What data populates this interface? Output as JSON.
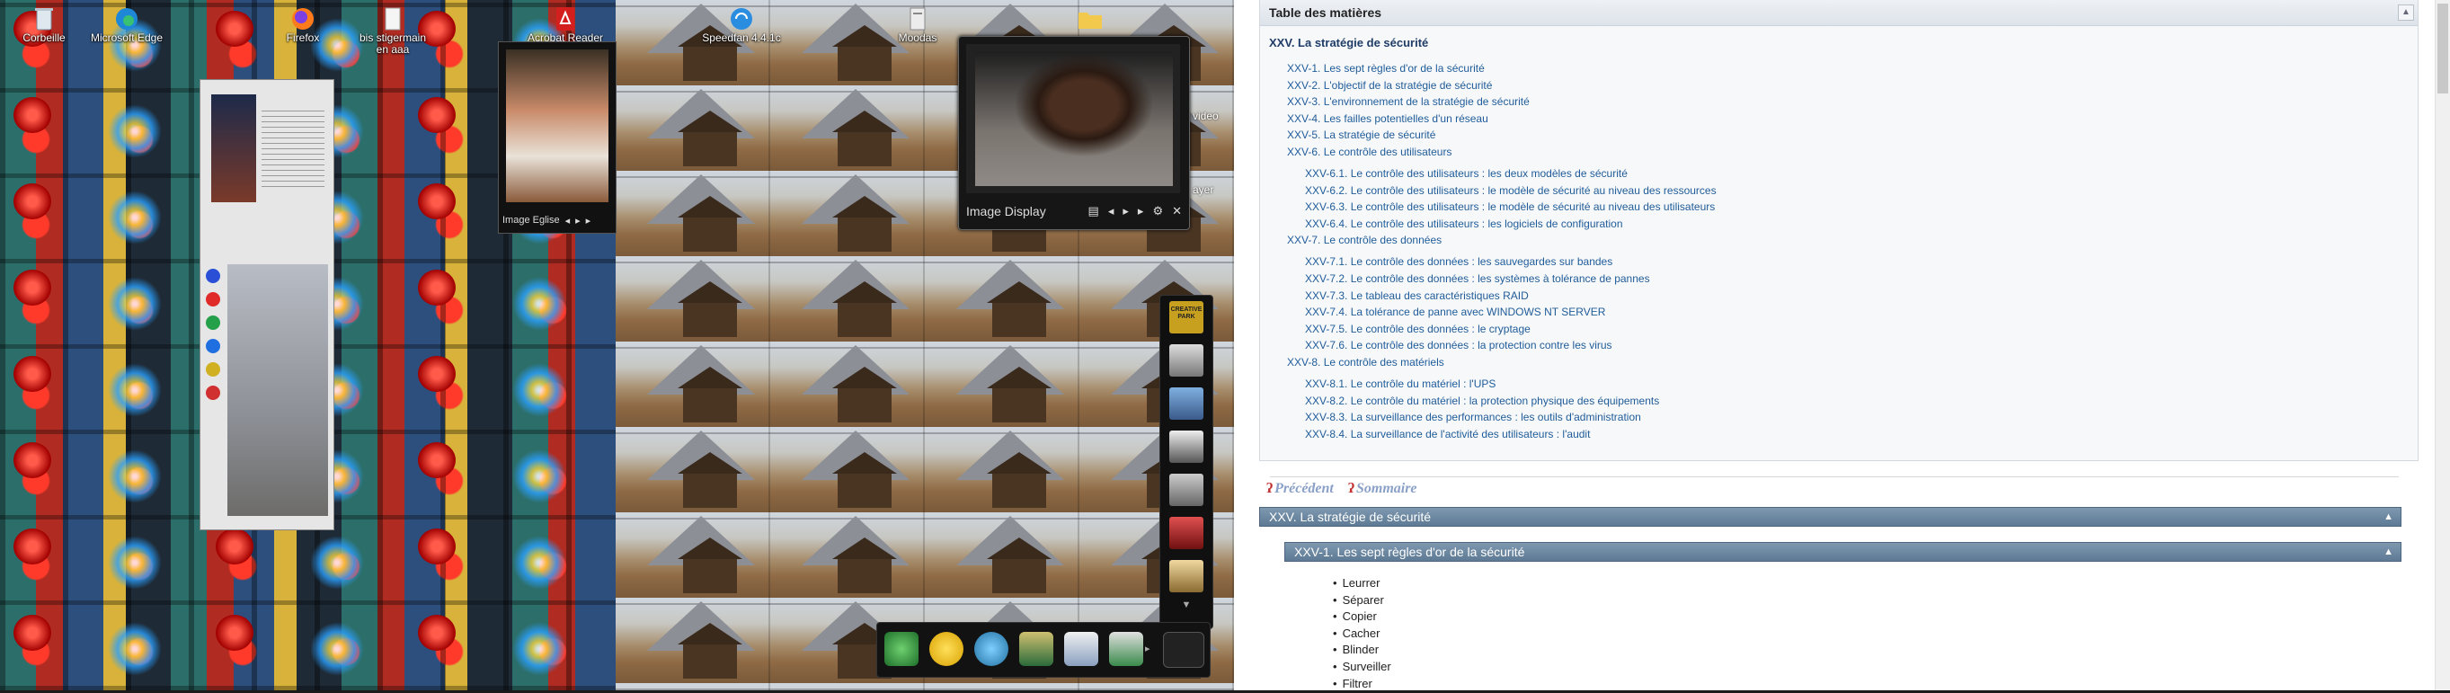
{
  "desktop": {
    "icons": [
      {
        "label": "Corbeille"
      },
      {
        "label": "Microsoft Edge"
      },
      {
        "label": "Firefox"
      },
      {
        "label": "bis stigermain en aaa"
      },
      {
        "label": "Acrobat Reader DC"
      },
      {
        "label": "Speedfan 4.4.1c"
      },
      {
        "label": "Moodas"
      }
    ],
    "image_display": {
      "title": "Image Display"
    },
    "small_viewer": {
      "title": "Image Eglise"
    },
    "side_captions": [
      "video",
      "ayer"
    ],
    "dock_tile_text": "CREATIVE PARK"
  },
  "browser": {
    "toc": {
      "header": "Table des matières",
      "toggle": "▲",
      "chapter": "XXV. La stratégie de sécurité",
      "items": [
        {
          "level": 1,
          "text": "XXV-1. Les sept règles d'or de la sécurité"
        },
        {
          "level": 1,
          "text": "XXV-2. L'objectif de la stratégie de sécurité"
        },
        {
          "level": 1,
          "text": "XXV-3. L'environnement de la stratégie de sécurité"
        },
        {
          "level": 1,
          "text": "XXV-4. Les failles potentielles d'un réseau"
        },
        {
          "level": 1,
          "text": "XXV-5. La stratégie de sécurité"
        },
        {
          "level": 1,
          "text": "XXV-6. Le contrôle des utilisateurs"
        },
        {
          "level": 2,
          "text": "XXV-6.1. Le contrôle des utilisateurs : les deux modèles de sécurité"
        },
        {
          "level": 2,
          "text": "XXV-6.2. Le contrôle des utilisateurs : le modèle de sécurité au niveau des ressources"
        },
        {
          "level": 2,
          "text": "XXV-6.3. Le contrôle des utilisateurs : le modèle de sécurité au niveau des utilisateurs"
        },
        {
          "level": 2,
          "text": "XXV-6.4. Le contrôle des utilisateurs : les logiciels de configuration"
        },
        {
          "level": 1,
          "text": "XXV-7. Le contrôle des données"
        },
        {
          "level": 2,
          "text": "XXV-7.1. Le contrôle des données : les sauvegardes sur bandes"
        },
        {
          "level": 2,
          "text": "XXV-7.2. Le contrôle des données : les systèmes à tolérance de pannes"
        },
        {
          "level": 2,
          "text": "XXV-7.3. Le tableau des caractéristiques RAID"
        },
        {
          "level": 2,
          "text": "XXV-7.4. La tolérance de panne avec WINDOWS NT SERVER"
        },
        {
          "level": 2,
          "text": "XXV-7.5. Le contrôle des données : le cryptage"
        },
        {
          "level": 2,
          "text": "XXV-7.6. Le contrôle des données : la protection contre les virus"
        },
        {
          "level": 1,
          "text": "XXV-8. Le contrôle des matériels"
        },
        {
          "level": 2,
          "text": "XXV-8.1. Le contrôle du matériel : l'UPS"
        },
        {
          "level": 2,
          "text": "XXV-8.2. Le contrôle du matériel : la protection physique des équipements"
        },
        {
          "level": 2,
          "text": "XXV-8.3. La surveillance des performances : les outils d'administration"
        },
        {
          "level": 2,
          "text": "XXV-8.4. La surveillance de l'activité des utilisateurs : l'audit"
        }
      ]
    },
    "nav": {
      "previous": "Précédent",
      "summary": "Sommaire"
    },
    "section_bar": "XXV. La stratégie de sécurité",
    "subsection_bar": "XXV-1. Les sept règles d'or de la sécurité",
    "bar_caret": "▲",
    "bullets": [
      "Leurrer",
      "Séparer",
      "Copier",
      "Cacher",
      "Blinder",
      "Surveiller",
      "Filtrer"
    ]
  }
}
